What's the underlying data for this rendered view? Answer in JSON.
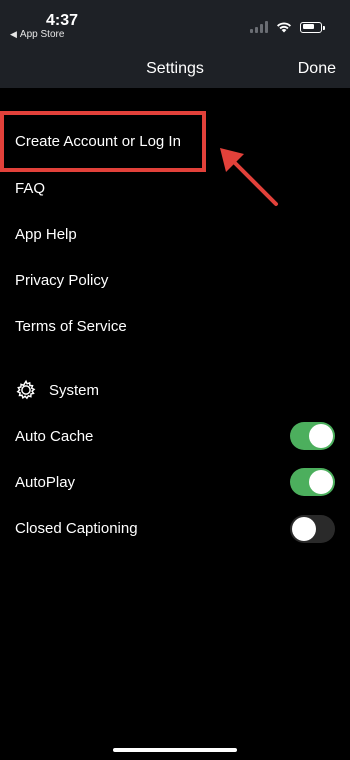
{
  "status_bar": {
    "time": "4:37",
    "back_label": "App Store",
    "signal_icon": "cellular-signal-icon",
    "wifi_icon": "wifi-icon",
    "battery_icon": "battery-icon"
  },
  "nav": {
    "title": "Settings",
    "done_label": "Done"
  },
  "menu": {
    "create_account": "Create Account or Log In",
    "faq": "FAQ",
    "app_help": "App Help",
    "privacy_policy": "Privacy Policy",
    "terms_of_service": "Terms of Service"
  },
  "system": {
    "label": "System",
    "icon": "gear-icon",
    "settings": [
      {
        "label": "Auto Cache",
        "on": true
      },
      {
        "label": "AutoPlay",
        "on": true
      },
      {
        "label": "Closed Captioning",
        "on": false
      }
    ]
  },
  "colors": {
    "highlight": "#e2413a",
    "toggle_on": "#4caf5d",
    "toggle_off": "#2a2a2a",
    "header_bg": "#1e2126"
  }
}
